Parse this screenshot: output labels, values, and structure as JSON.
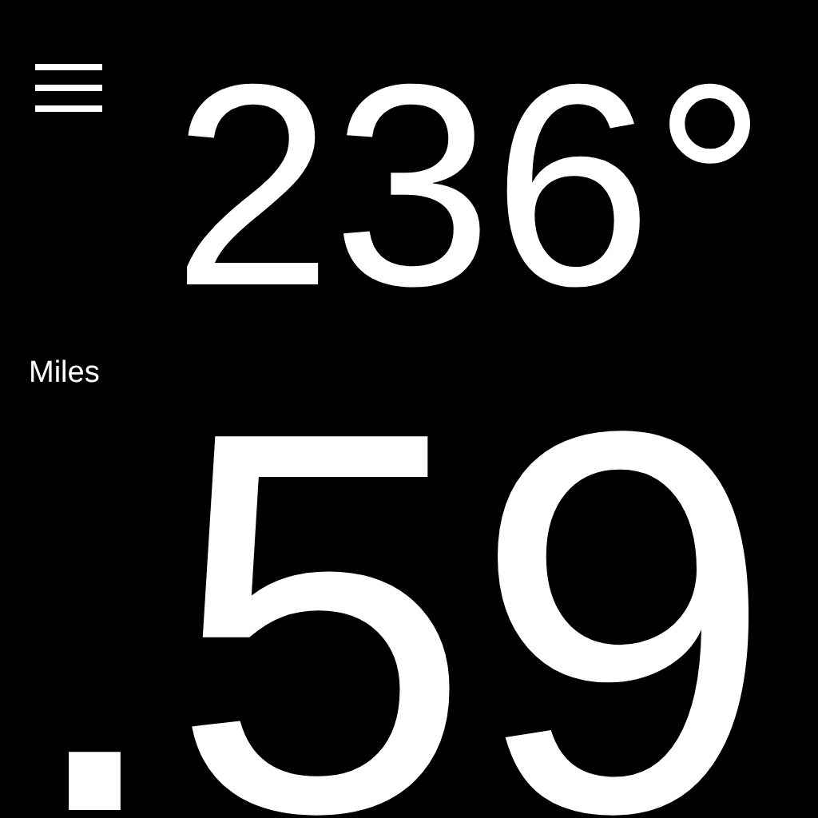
{
  "heading": {
    "value": "236°"
  },
  "distance": {
    "unit": "Miles",
    "value": ".59"
  }
}
